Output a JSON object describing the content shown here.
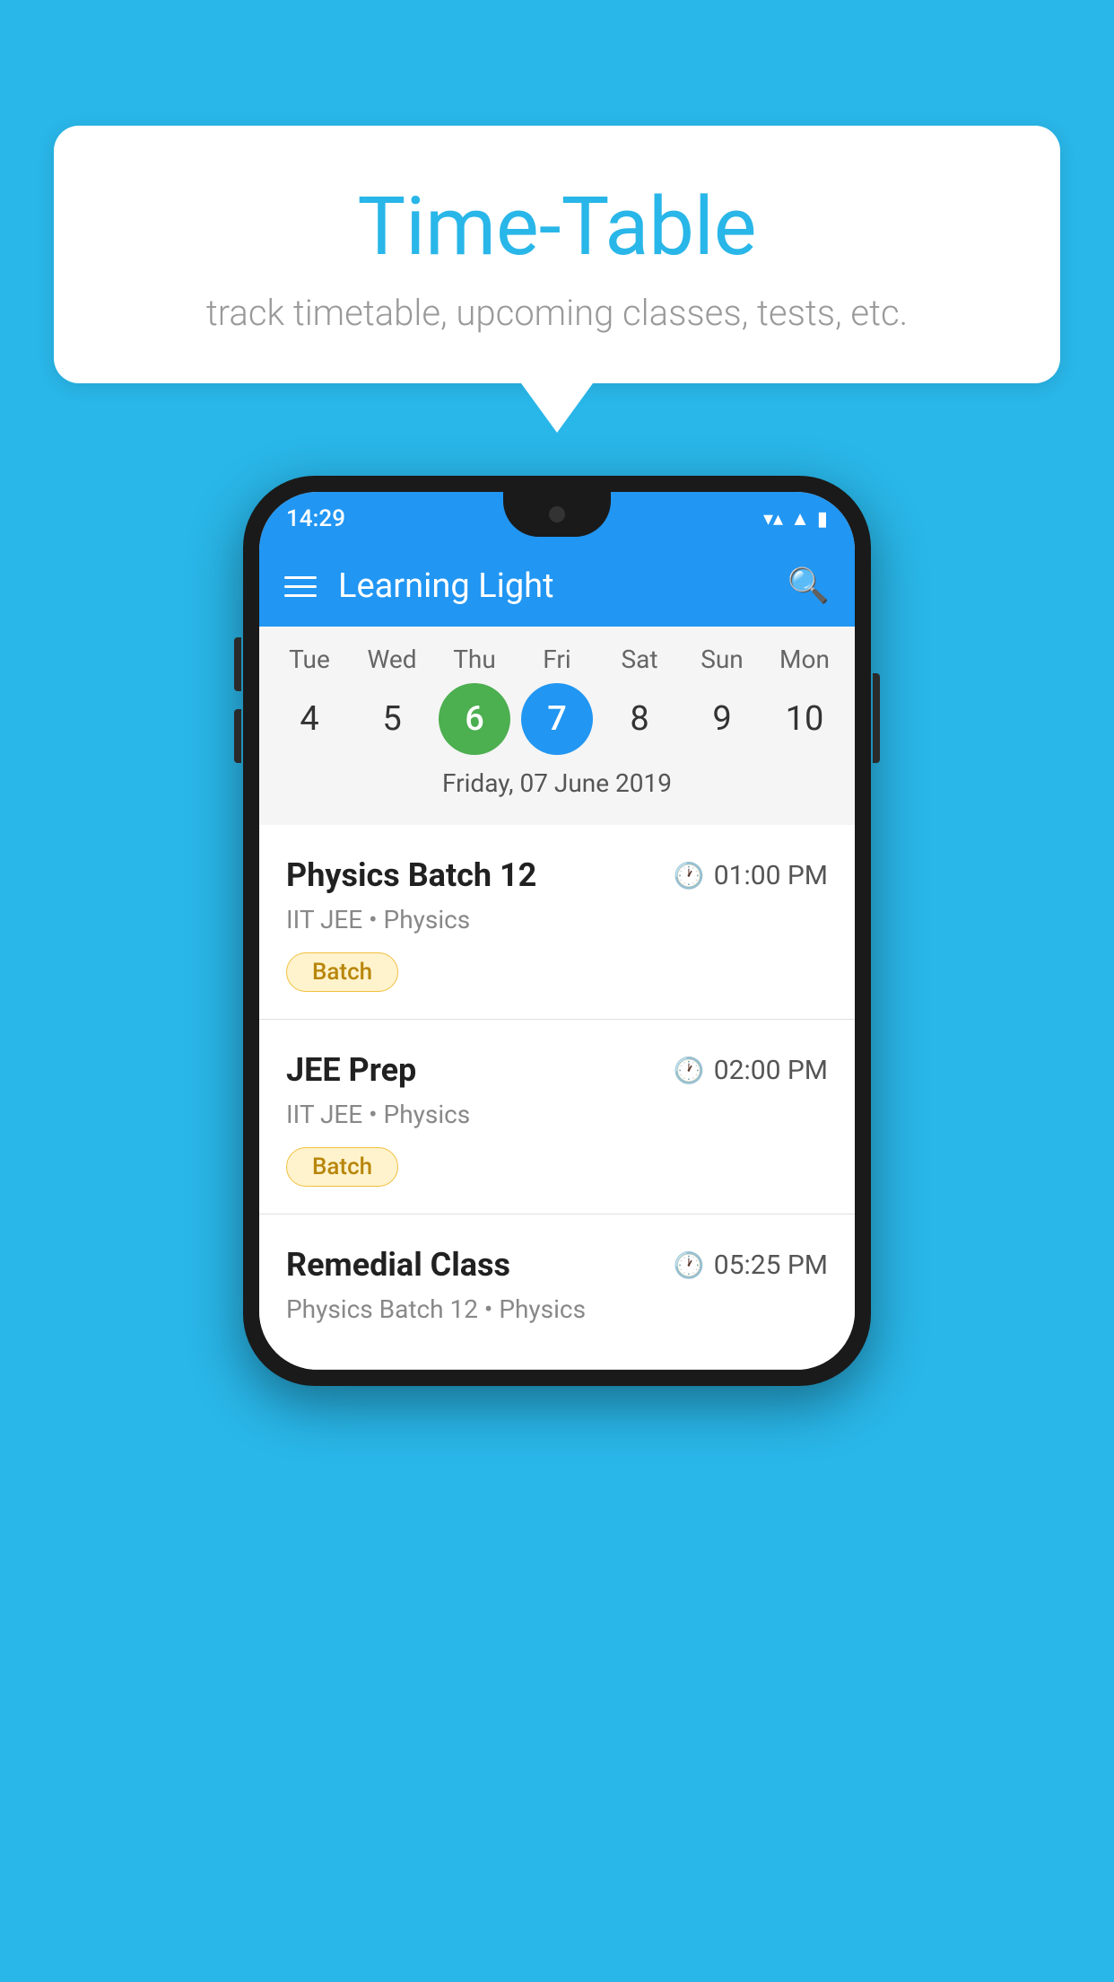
{
  "background_color": "#29b6e8",
  "speech_bubble": {
    "title": "Time-Table",
    "subtitle": "track timetable, upcoming classes, tests, etc."
  },
  "phone": {
    "status_bar": {
      "time": "14:29",
      "wifi_icon": "▼▲",
      "signal_icon": "▲",
      "battery_icon": "▮"
    },
    "app_bar": {
      "title": "Learning Light",
      "menu_label": "menu",
      "search_label": "search"
    },
    "calendar": {
      "days": [
        {
          "label": "Tue",
          "num": "4"
        },
        {
          "label": "Wed",
          "num": "5"
        },
        {
          "label": "Thu",
          "num": "6",
          "state": "today"
        },
        {
          "label": "Fri",
          "num": "7",
          "state": "selected"
        },
        {
          "label": "Sat",
          "num": "8"
        },
        {
          "label": "Sun",
          "num": "9"
        },
        {
          "label": "Mon",
          "num": "10"
        }
      ],
      "selected_date_label": "Friday, 07 June 2019"
    },
    "classes": [
      {
        "name": "Physics Batch 12",
        "time": "01:00 PM",
        "meta": "IIT JEE • Physics",
        "badge": "Batch"
      },
      {
        "name": "JEE Prep",
        "time": "02:00 PM",
        "meta": "IIT JEE • Physics",
        "badge": "Batch"
      },
      {
        "name": "Remedial Class",
        "time": "05:25 PM",
        "meta": "Physics Batch 12 • Physics",
        "badge": ""
      }
    ]
  }
}
